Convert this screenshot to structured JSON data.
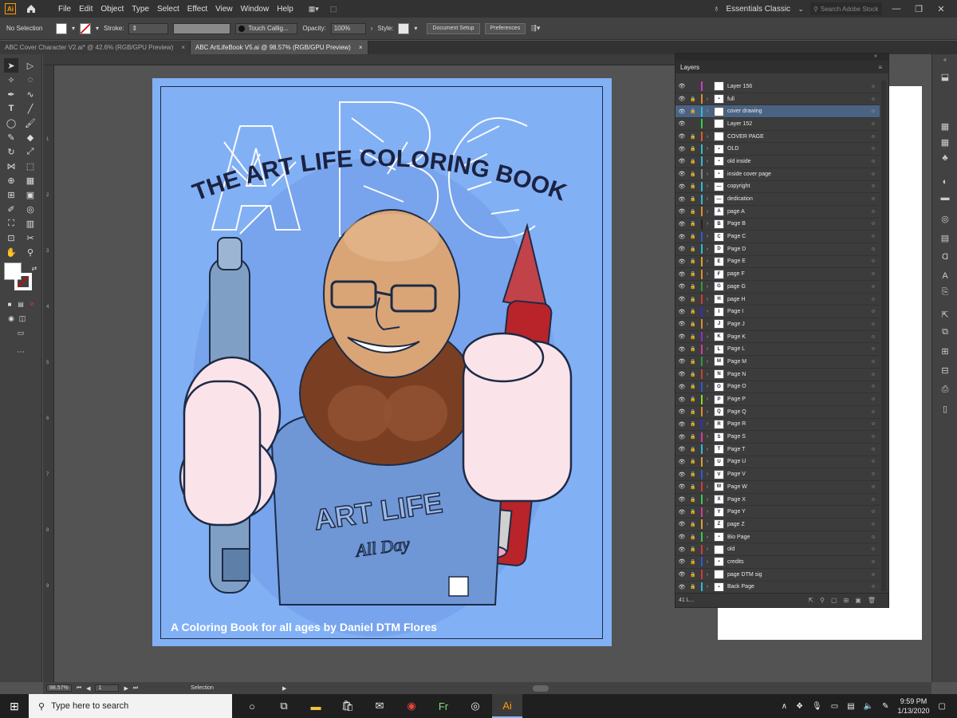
{
  "menubar": {
    "app_logo": "Ai",
    "items": [
      "File",
      "Edit",
      "Object",
      "Type",
      "Select",
      "Effect",
      "View",
      "Window",
      "Help"
    ],
    "workspace": "Essentials Classic",
    "search_placeholder": "Search Adobe Stock"
  },
  "controlbar": {
    "selection": "No Selection",
    "stroke_label": "Stroke:",
    "brush": "Touch Callig...",
    "opacity_label": "Opacity:",
    "opacity_value": "100%",
    "style_label": "Style:",
    "document_setup": "Document Setup",
    "preferences": "Preferences"
  },
  "tabs": [
    {
      "label": "ABC Cover Character V2.ai* @ 42.6% (RGB/GPU Preview)",
      "close": "×"
    },
    {
      "label": "ABC ArtLifeBook V5.ai @ 98.57% (RGB/GPU Preview)",
      "close": "×"
    }
  ],
  "ruler_left_marks": [
    "1",
    "2",
    "3",
    "4",
    "5",
    "6",
    "7",
    "8",
    "9"
  ],
  "artwork": {
    "title": "THE ART LIFE COLORING BOOK",
    "shirt_line1": "ART LIFE",
    "shirt_line2": "All Day",
    "subtitle": "A Coloring Book for all ages by Daniel DTM Flores",
    "colors": {
      "background": "#82b0f5",
      "skin": "#d9a577",
      "beard": "#7a3f22",
      "glove": "#fbe3ea",
      "shirt": "#6f97d6",
      "pencil": "#b8242a"
    }
  },
  "layers_panel": {
    "title": "Layers",
    "count": "41 L...",
    "layers": [
      {
        "name": "Layer 156",
        "color": "#d13ac8",
        "thumb": "",
        "lock": false,
        "arrow": false
      },
      {
        "name": "full",
        "color": "#e08a2e",
        "thumb": "▪",
        "lock": true,
        "arrow": true
      },
      {
        "name": "cover drawing",
        "color": "#2ebbd6",
        "thumb": "",
        "lock": true,
        "arrow": true,
        "selected": true
      },
      {
        "name": "Layer 152",
        "color": "#36c950",
        "thumb": "",
        "lock": false,
        "arrow": false
      },
      {
        "name": "COVER PAGE",
        "color": "#e0572e",
        "thumb": "",
        "lock": true,
        "arrow": true
      },
      {
        "name": "OLD",
        "color": "#2ebbd6",
        "thumb": "▪",
        "lock": true,
        "arrow": true
      },
      {
        "name": "old inside",
        "color": "#2ebbd6",
        "thumb": "▪",
        "lock": true,
        "arrow": true
      },
      {
        "name": "inside cover page",
        "color": "#888888",
        "thumb": "▪",
        "lock": true,
        "arrow": true
      },
      {
        "name": "copyright",
        "color": "#2ebbd6",
        "thumb": "—",
        "lock": true,
        "arrow": true
      },
      {
        "name": "dedication",
        "color": "#2ebbd6",
        "thumb": "—",
        "lock": true,
        "arrow": true
      },
      {
        "name": "page A",
        "color": "#e08a2e",
        "thumb": "A",
        "lock": true,
        "arrow": true
      },
      {
        "name": "Page B",
        "color": "#222222",
        "thumb": "B",
        "lock": true,
        "arrow": true
      },
      {
        "name": "Page C",
        "color": "#2e5bd6",
        "thumb": "C",
        "lock": true,
        "arrow": true
      },
      {
        "name": "Page D",
        "color": "#2ebbd6",
        "thumb": "D",
        "lock": true,
        "arrow": true
      },
      {
        "name": "Page E",
        "color": "#e0a02e",
        "thumb": "E",
        "lock": true,
        "arrow": true
      },
      {
        "name": "page F",
        "color": "#e08a2e",
        "thumb": "F",
        "lock": true,
        "arrow": true
      },
      {
        "name": "page G",
        "color": "#2e9b3a",
        "thumb": "G",
        "lock": true,
        "arrow": true
      },
      {
        "name": "page H",
        "color": "#d13a3a",
        "thumb": "H",
        "lock": true,
        "arrow": true
      },
      {
        "name": "Page I",
        "color": "#2e2ed6",
        "thumb": "I",
        "lock": true,
        "arrow": true
      },
      {
        "name": "Page J",
        "color": "#e08a2e",
        "thumb": "J",
        "lock": true,
        "arrow": true
      },
      {
        "name": "Page K",
        "color": "#8a2ed6",
        "thumb": "K",
        "lock": true,
        "arrow": true
      },
      {
        "name": "Page L",
        "color": "#d63aa0",
        "thumb": "L",
        "lock": true,
        "arrow": true
      },
      {
        "name": "Page M",
        "color": "#2e9b3a",
        "thumb": "M",
        "lock": true,
        "arrow": true
      },
      {
        "name": "Page N",
        "color": "#d13a3a",
        "thumb": "N",
        "lock": true,
        "arrow": true
      },
      {
        "name": "Page O",
        "color": "#2e5bd6",
        "thumb": "O",
        "lock": true,
        "arrow": true
      },
      {
        "name": "Page P",
        "color": "#8ad62e",
        "thumb": "P",
        "lock": true,
        "arrow": true
      },
      {
        "name": "Page Q",
        "color": "#e08a2e",
        "thumb": "Q",
        "lock": true,
        "arrow": true
      },
      {
        "name": "Page R",
        "color": "#2e2ed6",
        "thumb": "R",
        "lock": true,
        "arrow": true
      },
      {
        "name": "Page S",
        "color": "#d63aa0",
        "thumb": "S",
        "lock": true,
        "arrow": true
      },
      {
        "name": "Page T",
        "color": "#2ebbd6",
        "thumb": "T",
        "lock": true,
        "arrow": true
      },
      {
        "name": "Page U",
        "color": "#d6a02e",
        "thumb": "U",
        "lock": true,
        "arrow": true
      },
      {
        "name": "Page V",
        "color": "#2e5bd6",
        "thumb": "V",
        "lock": true,
        "arrow": true
      },
      {
        "name": "Page W",
        "color": "#d13a3a",
        "thumb": "W",
        "lock": true,
        "arrow": true
      },
      {
        "name": "Page X",
        "color": "#36c950",
        "thumb": "X",
        "lock": true,
        "arrow": true
      },
      {
        "name": "Page Y",
        "color": "#d63aa0",
        "thumb": "Y",
        "lock": true,
        "arrow": true
      },
      {
        "name": "page Z",
        "color": "#e0a02e",
        "thumb": "Z",
        "lock": true,
        "arrow": true
      },
      {
        "name": "Bio Page",
        "color": "#36c950",
        "thumb": "▪",
        "lock": true,
        "arrow": true
      },
      {
        "name": "old",
        "color": "#d13a3a",
        "thumb": "",
        "lock": true,
        "arrow": true
      },
      {
        "name": "credits",
        "color": "#2e5bd6",
        "thumb": "▪",
        "lock": true,
        "arrow": true
      },
      {
        "name": "page DTM sig",
        "color": "#d13a3a",
        "thumb": "",
        "lock": true,
        "arrow": true
      },
      {
        "name": "Back Page",
        "color": "#2ebbd6",
        "thumb": "▪",
        "lock": true,
        "arrow": true
      }
    ]
  },
  "statusbar": {
    "zoom": "98.57%",
    "page": "1",
    "tool": "Selection"
  },
  "taskbar": {
    "search_placeholder": "Type here to search",
    "time": "9:59 PM",
    "date": "1/13/2020"
  }
}
